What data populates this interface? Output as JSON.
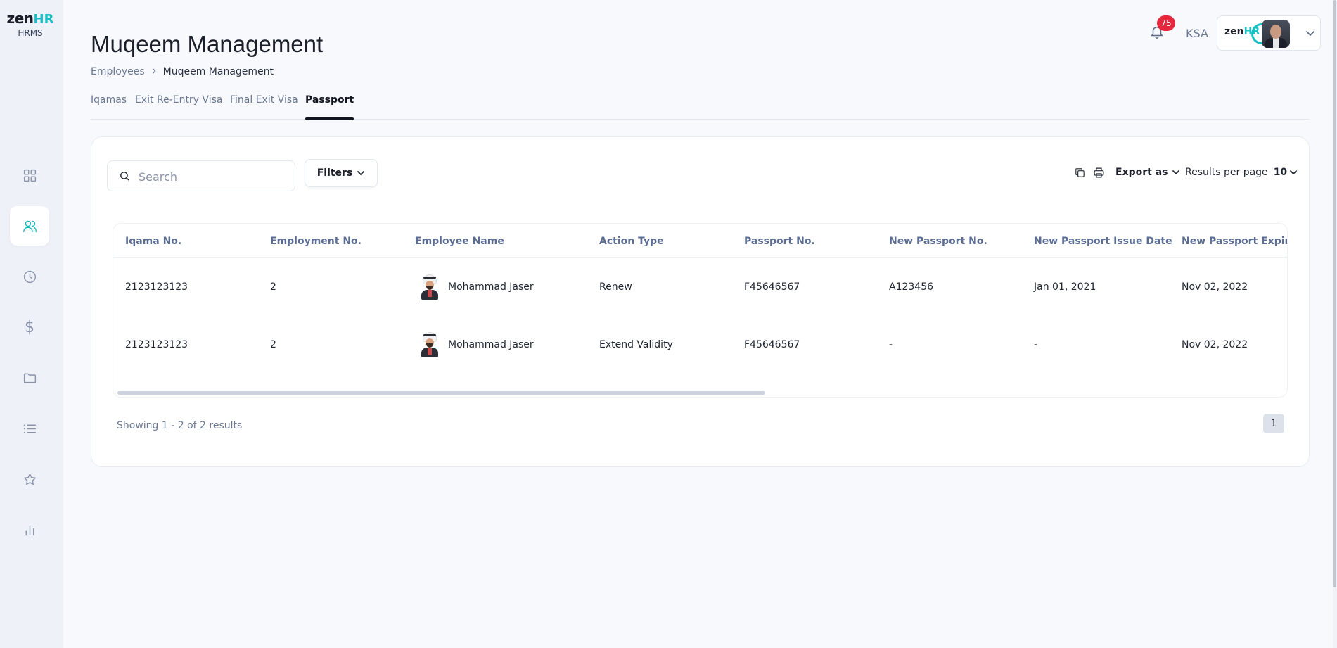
{
  "brand": {
    "name_zen": "zen",
    "name_hr": "HR",
    "subtitle": "HRMS"
  },
  "sidebar": {
    "items": [
      {
        "icon": "grid-icon"
      },
      {
        "icon": "users-icon",
        "active": true
      },
      {
        "icon": "clock-icon"
      },
      {
        "icon": "dollar-icon",
        "glyph": "$"
      },
      {
        "icon": "folder-icon"
      },
      {
        "icon": "list-icon"
      },
      {
        "icon": "star-icon"
      },
      {
        "icon": "bar-chart-icon"
      }
    ]
  },
  "header": {
    "title": "Muqeem Management",
    "breadcrumb": {
      "parent": "Employees",
      "current": "Muqeem Management"
    },
    "notifications_count": "75",
    "region": "KSA",
    "account_logo_zen": "zen",
    "account_logo_hr": "HR"
  },
  "tabs": [
    {
      "label": "Iqamas"
    },
    {
      "label": "Exit Re-Entry Visa"
    },
    {
      "label": "Final Exit Visa"
    },
    {
      "label": "Passport",
      "active": true
    }
  ],
  "toolbar": {
    "search_placeholder": "Search",
    "filters_label": "Filters",
    "export_label": "Export as",
    "results_per_page_label": "Results per page",
    "results_per_page_value": "10"
  },
  "table": {
    "columns": [
      "Iqama No.",
      "Employment No.",
      "Employee Name",
      "Action Type",
      "Passport No.",
      "New Passport No.",
      "New Passport Issue Date",
      "New Passport Expiry D"
    ],
    "rows": [
      {
        "iqama": "2123123123",
        "employment": "2",
        "name": "Mohammad Jaser",
        "action": "Renew",
        "passport": "F45646567",
        "new_passport": "A123456",
        "issue_date": "Jan 01, 2021",
        "expiry_date": "Nov 02, 2022"
      },
      {
        "iqama": "2123123123",
        "employment": "2",
        "name": "Mohammad Jaser",
        "action": "Extend Validity",
        "passport": "F45646567",
        "new_passport": "-",
        "issue_date": "-",
        "expiry_date": "Nov 02, 2022"
      }
    ]
  },
  "pagination": {
    "summary": "Showing 1 - 2 of 2 results",
    "current_page": "1"
  },
  "colors": {
    "accent": "#18c0c6",
    "badge": "#e5283d",
    "header_text": "#5b6d93"
  }
}
